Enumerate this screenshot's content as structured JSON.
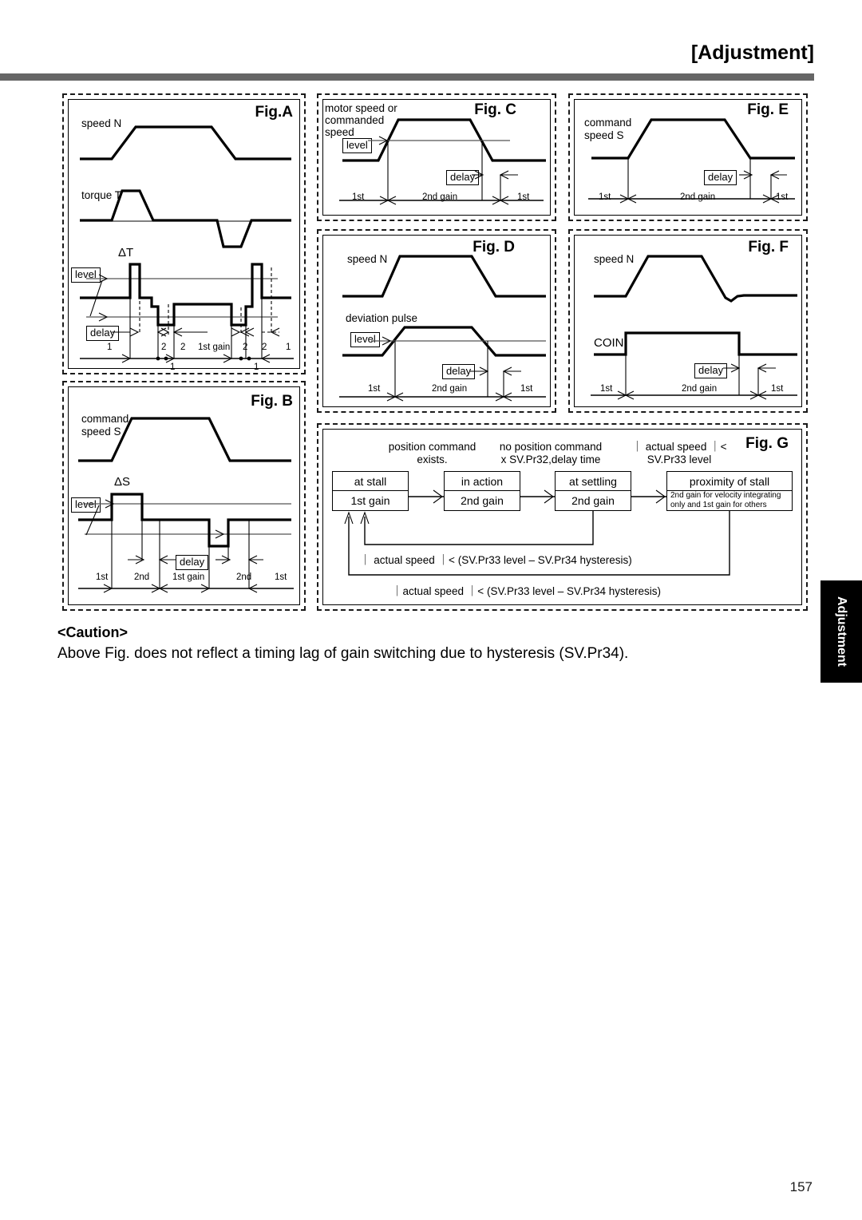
{
  "header": {
    "title": "[Adjustment]",
    "rule_color": "#666666"
  },
  "side_tab": {
    "label": "Adjustment",
    "bg_color": "#000000",
    "text_color": "#ffffff"
  },
  "figures": {
    "a": {
      "label": "Fig.A",
      "axis1_label": "speed N",
      "axis2_label": "torque T",
      "delta_label": "ΔT",
      "level_box": "level",
      "delay_box": "delay",
      "ticks": [
        "1",
        "2",
        "2",
        "1st gain",
        "2",
        "2",
        "1"
      ],
      "sub_ticks": [
        "1",
        "1"
      ]
    },
    "b": {
      "label": "Fig. B",
      "axis1_label_line1": "command",
      "axis1_label_line2": "speed S",
      "delta_label": "ΔS",
      "level_box": "level",
      "delay_box": "delay",
      "ticks": [
        "1st",
        "2nd",
        "1st gain",
        "2nd",
        "1st"
      ]
    },
    "c": {
      "label": "Fig. C",
      "axis_label_line1": "motor speed or",
      "axis_label_line2": "commanded",
      "axis_label_line3": "speed",
      "level_box": "level",
      "delay_box": "delay",
      "ticks": [
        "1st",
        "2nd gain",
        "1st"
      ]
    },
    "d": {
      "label": "Fig. D",
      "axis1_label": "speed N",
      "axis2_label": "deviation pulse",
      "level_box": "level",
      "delay_box": "delay",
      "ticks": [
        "1st",
        "2nd gain",
        "1st"
      ]
    },
    "e": {
      "label": "Fig. E",
      "axis_label_line1": "command",
      "axis_label_line2": "speed  S",
      "delay_box": "delay",
      "ticks": [
        "1st",
        "2nd gain",
        "1st"
      ]
    },
    "f": {
      "label": "Fig. F",
      "axis1_label": "speed N",
      "axis2_label": "COIN",
      "delay_box": "delay",
      "ticks": [
        "1st",
        "2nd gain",
        "1st"
      ]
    },
    "g": {
      "label": "Fig. G",
      "conditions": [
        {
          "line1": "position command",
          "line2": "exists."
        },
        {
          "line1": "no position command",
          "line2": "x SV.Pr32,delay time"
        },
        {
          "line1": "｜ actual speed ｜<",
          "line2": "SV.Pr33 level"
        }
      ],
      "nodes": [
        {
          "state": "at stall",
          "gain": "1st gain"
        },
        {
          "state": "in action",
          "gain": "2nd gain"
        },
        {
          "state": "at settling",
          "gain": "2nd gain"
        },
        {
          "state": "proximity of stall",
          "gain_line1": "2nd gain for velocity integrating",
          "gain_line2": "only and 1st gain for others"
        }
      ],
      "feedback_1": "｜ actual speed ｜< (SV.Pr33 level – SV.Pr34 hysteresis)",
      "feedback_2": "｜actual speed ｜< (SV.Pr33 level – SV.Pr34 hysteresis)"
    }
  },
  "caution": {
    "heading": "<Caution>",
    "text": "Above Fig. does not reflect a timing lag of gain switching due to hysteresis (SV.Pr34)."
  },
  "footer": {
    "page_number": "157"
  }
}
